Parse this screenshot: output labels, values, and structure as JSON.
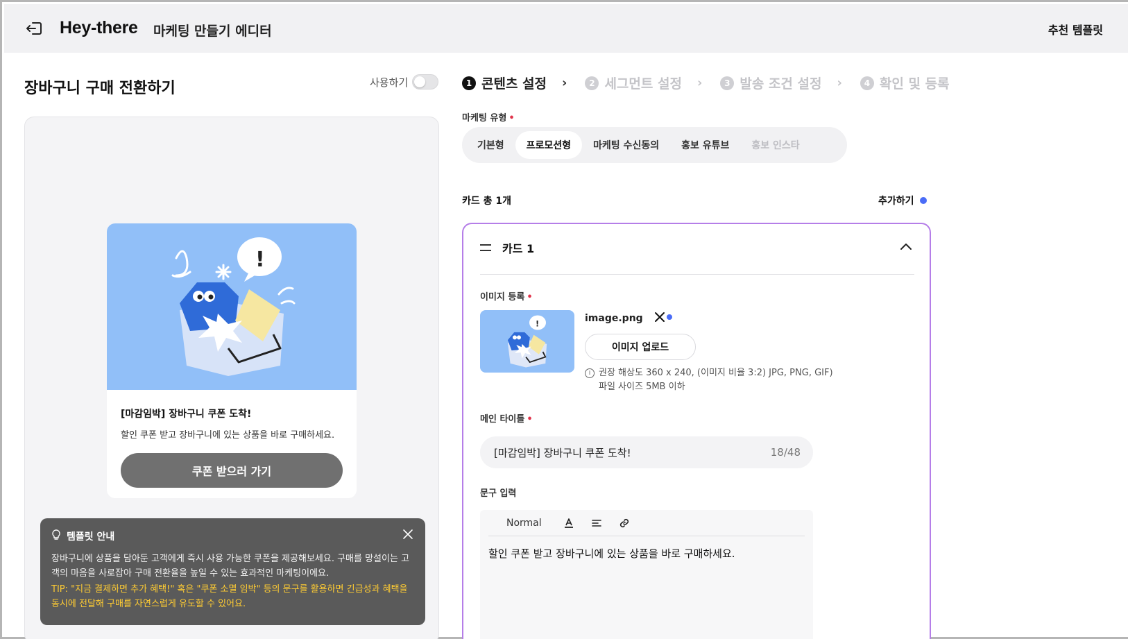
{
  "header": {
    "brand": "Hey-there",
    "subtitle": "마케팅 만들기 에디터",
    "recommended_template": "추천 템플릿"
  },
  "left": {
    "title": "장바구니 구매 전환하기",
    "toggle_label": "사용하기",
    "toggle_on": false,
    "preview": {
      "title": "[마감임박] 장바구니 쿠폰 도착!",
      "description": "할인 쿠폰 받고 장바구니에 있는 상품을 바로 구매하세요.",
      "button": "쿠폰 받으러 가기"
    },
    "guide": {
      "heading": "템플릿 안내",
      "text": "장바구니에 상품을 담아둔 고객에게 즉시 사용 가능한 쿠폰을 제공해보세요. 구매를 망설이는 고객의 마음을 사로잡아 구매 전환율을 높일 수 있는 효과적인 마케팅이에요.",
      "tip": "TIP: \"지금 결제하면 추가 혜택!\" 혹은 \"쿠폰 소멸 임박\" 등의 문구를 활용하면 긴급성과 혜택을 동시에 전달해 구매를 자연스럽게 유도할 수 있어요."
    }
  },
  "steps": [
    {
      "num": "1",
      "label": "콘텐츠 설정",
      "active": true
    },
    {
      "num": "2",
      "label": "세그먼트 설정",
      "active": false
    },
    {
      "num": "3",
      "label": "발송 조건 설정",
      "active": false
    },
    {
      "num": "4",
      "label": "확인 및 등록",
      "active": false
    }
  ],
  "marketing_type": {
    "label": "마케팅 유형",
    "tabs": [
      {
        "label": "기본형",
        "state": "normal"
      },
      {
        "label": "프로모션형",
        "state": "active"
      },
      {
        "label": "마케팅 수신동의",
        "state": "normal"
      },
      {
        "label": "홍보 유튜브",
        "state": "normal"
      },
      {
        "label": "홍보 인스타",
        "state": "disabled"
      }
    ]
  },
  "cards": {
    "count_label": "카드 총 1개",
    "add_label": "추가하기",
    "accent": "#4a6cf7",
    "card": {
      "name": "카드 1",
      "image_label": "이미지 등록",
      "file_name": "image.png",
      "upload_button": "이미지 업로드",
      "hint_line1": "권장 해상도 360 x 240, (이미지 비율 3:2) JPG, PNG, GIF)",
      "hint_line2": "파일 사이즈 5MB 이하",
      "main_title_label": "메인 타이틀",
      "main_title_value": "[마감임박] 장바구니 쿠폰 도착!",
      "main_title_count": "18/48",
      "text_input_label": "문구 입력",
      "toolbar_style": "Normal",
      "body_text": "할인 쿠폰 받고 장바구니에 있는 상품을 바로 구매하세요."
    }
  }
}
